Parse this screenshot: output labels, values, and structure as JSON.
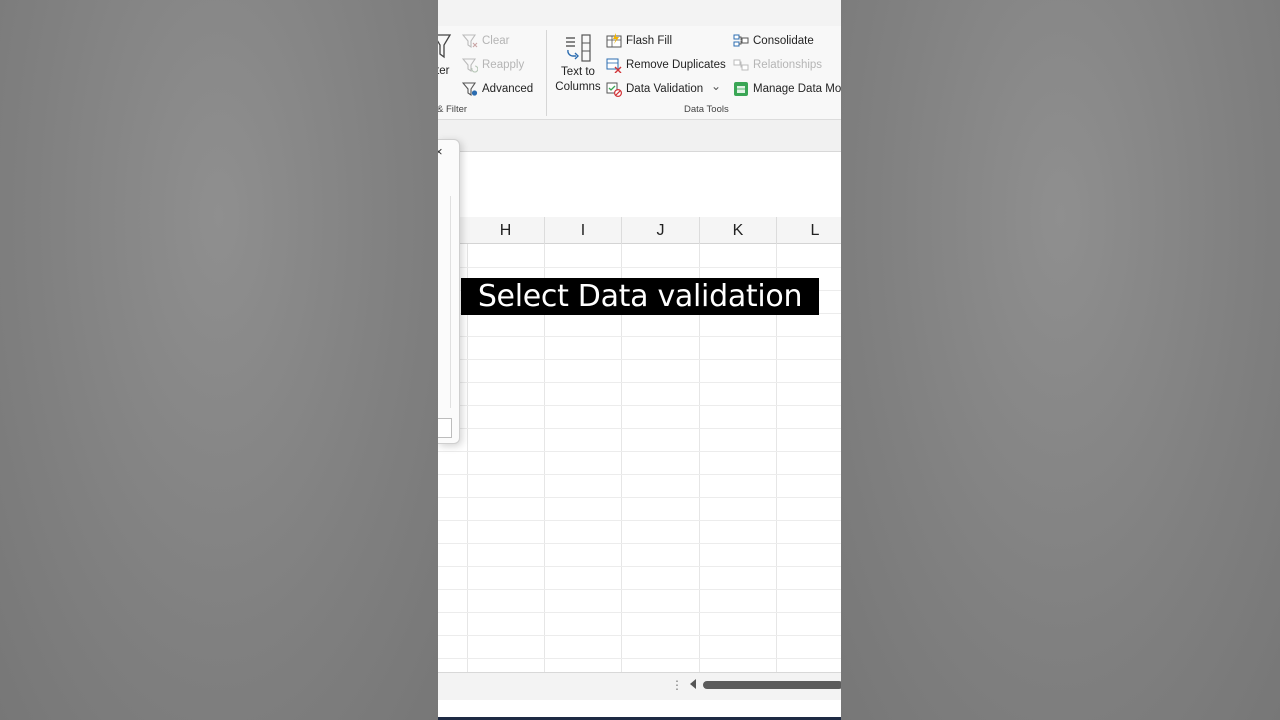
{
  "ribbon": {
    "sort_filter": {
      "filter_partial": "ter",
      "clear": "Clear",
      "reapply": "Reapply",
      "advanced": "Advanced",
      "group_label": "& Filter"
    },
    "data_tools": {
      "text_to_columns_line1": "Text to",
      "text_to_columns_line2": "Columns",
      "flash_fill": "Flash Fill",
      "remove_duplicates": "Remove Duplicates",
      "data_validation": "Data Validation",
      "dropdown_arrow": "⌄",
      "consolidate": "Consolidate",
      "relationships": "Relationships",
      "manage_data_model": "Manage Data Moc",
      "group_label": "Data Tools"
    }
  },
  "dialog": {
    "close_glyph": "×"
  },
  "columns": [
    "H",
    "I",
    "J",
    "K",
    "L"
  ],
  "caption": "Select Data validation",
  "colors": {
    "accent_green": "#3aa655",
    "icon_blue": "#2b6cb0",
    "icon_red": "#d13438"
  }
}
